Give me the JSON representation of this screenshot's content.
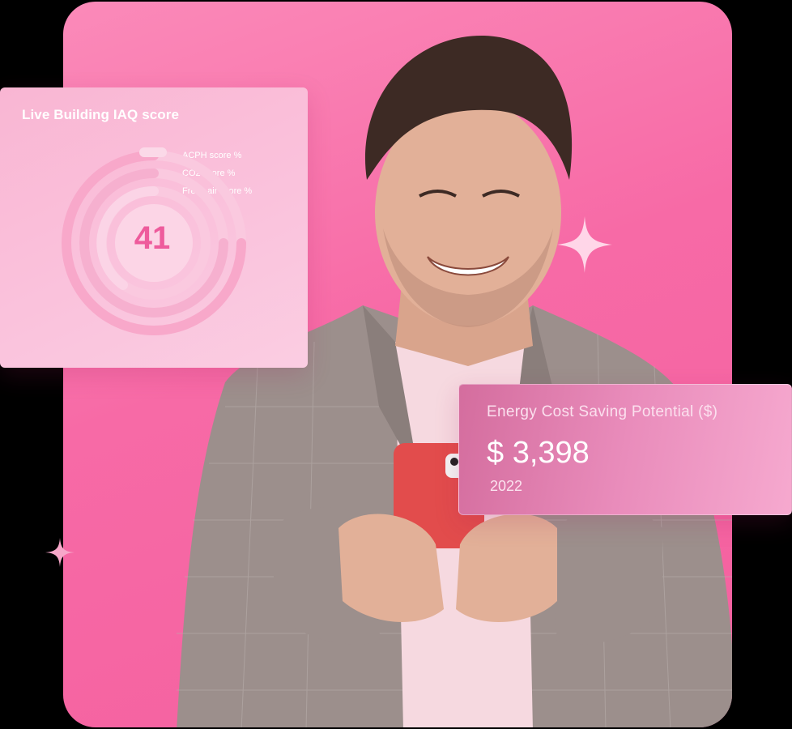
{
  "iaq_card": {
    "title": "Live Building IAQ score",
    "legend": [
      "ACPH score %",
      "CO2 score %",
      "Fresh air score %"
    ],
    "score": "41"
  },
  "energy_card": {
    "title": "Energy Cost Saving Potential ($)",
    "value": "$ 3,398",
    "year": "2022"
  },
  "colors": {
    "panel_pink": "#f76aa6",
    "score_pink": "#ee5b9c",
    "card_pink": "#fac2dc"
  },
  "icons": [
    "sparkle-icon"
  ]
}
